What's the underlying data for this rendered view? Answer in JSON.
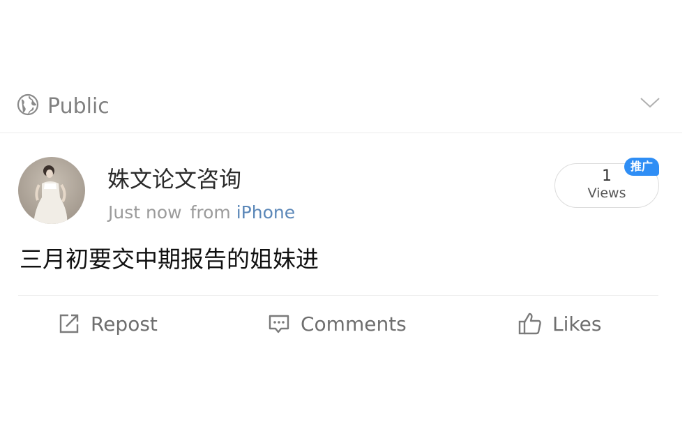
{
  "visibility": {
    "icon": "globe-icon",
    "label": "Public",
    "menu_icon": "chevron-down-icon"
  },
  "post": {
    "author": {
      "name": "姝文论文咨询",
      "avatar": "avatar-photo"
    },
    "meta": {
      "time": "Just now",
      "from_label": "from",
      "source": "iPhone"
    },
    "views": {
      "count": "1",
      "label": "Views",
      "badge": "推广"
    },
    "text": "三月初要交中期报告的姐妹进"
  },
  "actions": {
    "repost": {
      "label": "Repost",
      "icon": "repost-icon"
    },
    "comments": {
      "label": "Comments",
      "icon": "comment-icon"
    },
    "likes": {
      "label": "Likes",
      "icon": "thumbs-up-icon"
    }
  },
  "colors": {
    "link": "#5b87b8",
    "badge": "#2f8ef5",
    "muted_text": "#9b9b9b"
  }
}
